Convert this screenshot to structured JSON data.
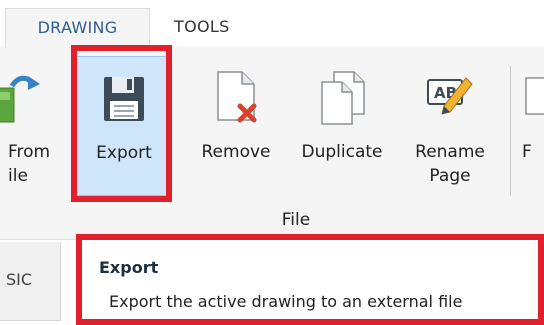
{
  "tabs": {
    "drawing": "DRAWING",
    "tools": "TOOLS"
  },
  "ribbon": {
    "from_label_line1": "From",
    "from_label_line2": "ile",
    "export_label": "Export",
    "remove_label": "Remove",
    "duplicate_label": "Duplicate",
    "rename_label_line1": "Rename",
    "rename_label_line2": "Page",
    "partial_label": "F",
    "group_label": "File",
    "rename_icon_text": "AB"
  },
  "side_tab": {
    "label": "SIC"
  },
  "tooltip": {
    "title": "Export",
    "description": "Export the active drawing to an external file"
  },
  "colors": {
    "highlight": "#e0202a",
    "export_selected_bg": "#cfe5fa",
    "drawing_tab_text": "#2f5f8f"
  },
  "icons": {
    "from": "import-from-file-icon",
    "export": "save-floppy-icon",
    "remove": "document-remove-icon",
    "duplicate": "document-duplicate-icon",
    "rename": "rename-pencil-icon"
  }
}
